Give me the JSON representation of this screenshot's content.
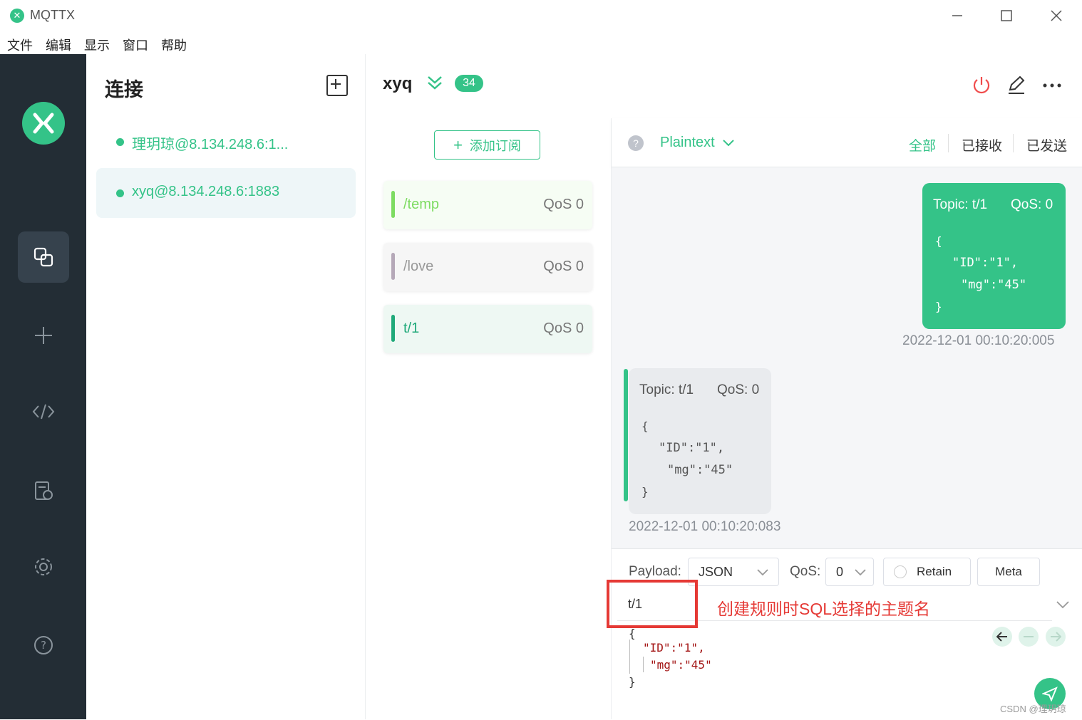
{
  "window": {
    "title": "MQTTX",
    "minimize_icon": "minimize-icon",
    "maximize_icon": "maximize-icon",
    "close_icon": "close-icon"
  },
  "menu": [
    "文件",
    "编辑",
    "显示",
    "窗口",
    "帮助"
  ],
  "connections": {
    "title": "连接",
    "items": [
      {
        "label": "理玥琼@8.134.248.6:1...",
        "selected": false,
        "status_color": "#34c388"
      },
      {
        "label": "xyq@8.134.248.6:1883",
        "selected": true,
        "status_color": "#34c388"
      }
    ]
  },
  "header": {
    "name": "xyq",
    "badge": "34"
  },
  "subscriptions": {
    "add_label": "添加订阅",
    "items": [
      {
        "topic": "/temp",
        "qos": "QoS 0",
        "color": "#7ddc61"
      },
      {
        "topic": "/love",
        "qos": "QoS 0",
        "color": "#b5a8b8"
      },
      {
        "topic": "t/1",
        "qos": "QoS 0",
        "color": "#1fa979"
      }
    ]
  },
  "toolbar": {
    "format": "Plaintext",
    "filters": [
      "全部",
      "已接收",
      "已发送"
    ]
  },
  "messages": [
    {
      "direction": "sent",
      "topic": "Topic: t/1",
      "qos": "QoS: 0",
      "lines": [
        "{",
        "\"ID\":\"1\",",
        "\"mg\":\"45\"",
        "}"
      ],
      "time": "2022-12-01 00:10:20:005"
    },
    {
      "direction": "received",
      "topic": "Topic: t/1",
      "qos": "QoS: 0",
      "lines": [
        "{",
        "\"ID\":\"1\",",
        "\"mg\":\"45\"",
        "}"
      ],
      "time": "2022-12-01 00:10:20:083"
    }
  ],
  "composer": {
    "payload_label": "Payload:",
    "payload_format": "JSON",
    "qos_label": "QoS:",
    "qos_value": "0",
    "retain_label": "Retain",
    "meta_label": "Meta",
    "topic": "t/1",
    "annotation": "创建规则时SQL选择的主题名",
    "editor_lines": [
      "{",
      "\"ID\":\"1\",",
      "\"mg\":\"45\"",
      "}"
    ]
  },
  "watermark": "CSDN @理玥琼",
  "colors": {
    "accent": "#34c388",
    "nav_bg": "#232d35",
    "annotation_red": "#e53935"
  }
}
